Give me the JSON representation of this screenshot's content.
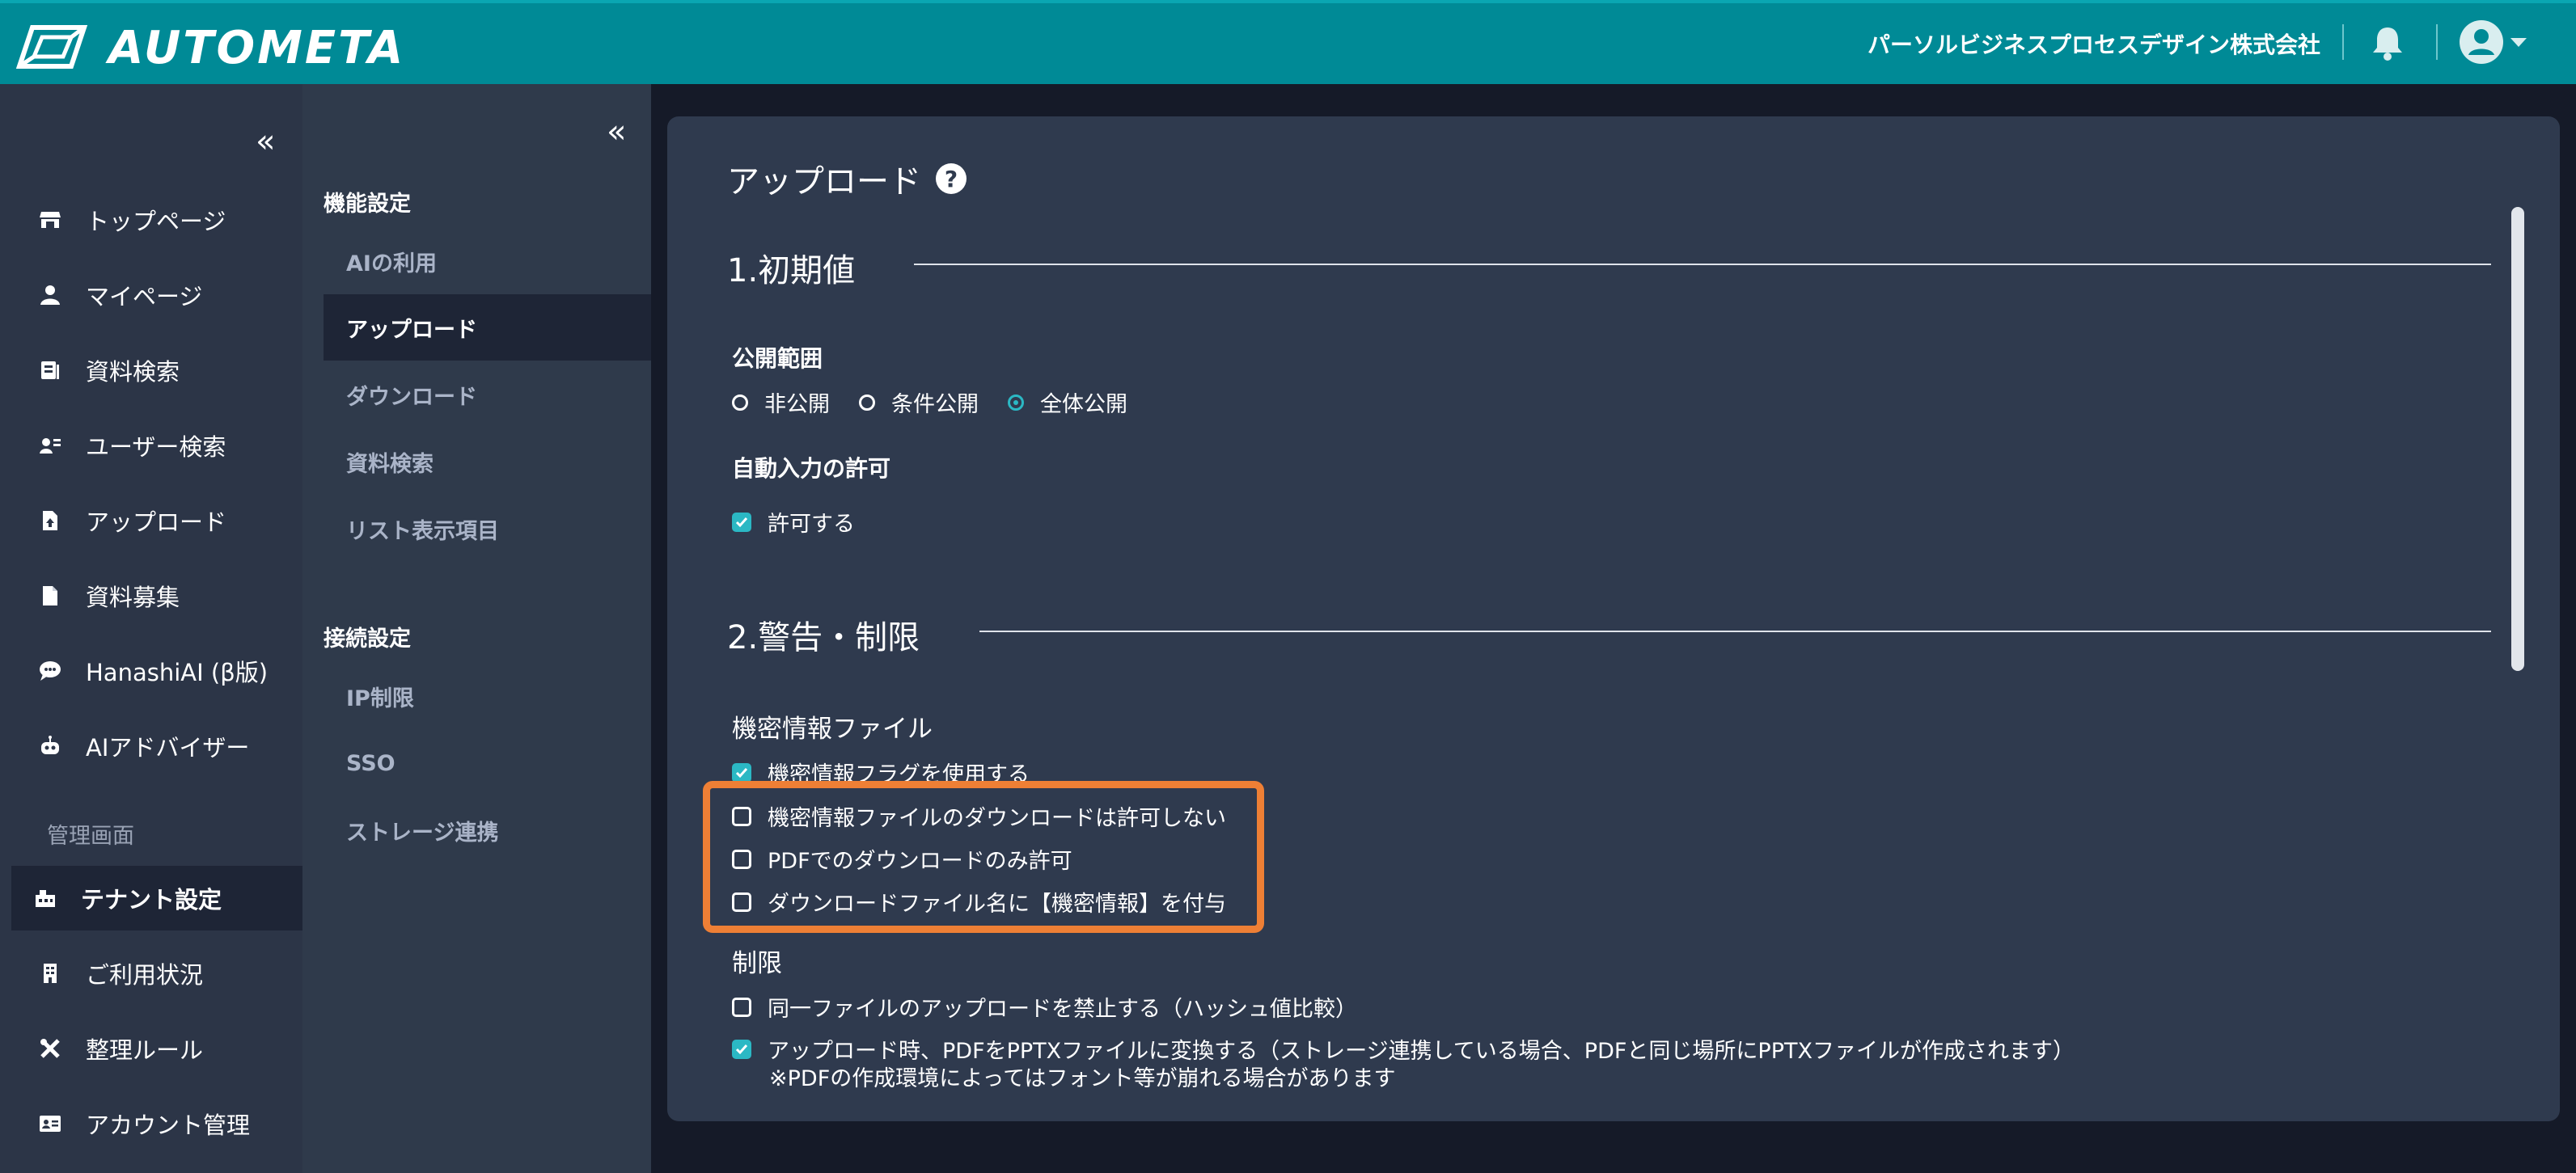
{
  "header": {
    "app_name": "AUTOMETA",
    "company": "パーソルビジネスプロセスデザイン株式会社",
    "icons": [
      "logo-icon",
      "bell-icon",
      "avatar-icon",
      "chevron-down-icon"
    ],
    "colors": {
      "header_bg": "#008a96",
      "accent": "#2bb8c4",
      "highlight": "#ee7f35"
    }
  },
  "sidebar": {
    "collapse_label": "«",
    "items": [
      {
        "label": "トップページ",
        "icon": "store-icon"
      },
      {
        "label": "マイページ",
        "icon": "person-icon"
      },
      {
        "label": "資料検索",
        "icon": "document-search-icon"
      },
      {
        "label": "ユーザー検索",
        "icon": "user-search-icon"
      },
      {
        "label": "アップロード",
        "icon": "upload-file-icon"
      },
      {
        "label": "資料募集",
        "icon": "file-icon"
      },
      {
        "label": "HanashiAI (β版)",
        "icon": "chat-icon"
      },
      {
        "label": "AIアドバイザー",
        "icon": "robot-icon"
      }
    ],
    "section_label": "管理画面",
    "admin_items": [
      {
        "label": "テナント設定",
        "icon": "tenant-icon",
        "active": true
      },
      {
        "label": "ご利用状況",
        "icon": "building-icon"
      },
      {
        "label": "整理ルール",
        "icon": "tools-icon"
      },
      {
        "label": "アカウント管理",
        "icon": "id-card-icon"
      }
    ]
  },
  "subsidebar": {
    "collapse_label": "«",
    "group1": "機能設定",
    "group1_items": [
      "AIの利用",
      "アップロード",
      "ダウンロード",
      "資料検索",
      "リスト表示項目"
    ],
    "group2": "接続設定",
    "group2_items": [
      "IP制限",
      "SSO",
      "ストレージ連携"
    ]
  },
  "main": {
    "title": "アップロード",
    "help": "?",
    "section1": {
      "title": "1.初期値",
      "visibility_label": "公開範囲",
      "visibility_options": [
        "非公開",
        "条件公開",
        "全体公開"
      ],
      "visibility_selected": "全体公開",
      "auto_input_label": "自動入力の許可",
      "auto_input_option": "許可する"
    },
    "section2": {
      "title": "2.警告・制限",
      "confidential_label": "機密情報ファイル",
      "confidential_options": [
        {
          "label": "機密情報フラグを使用する",
          "checked": true
        },
        {
          "label": "機密情報ファイルのダウンロードは許可しない",
          "checked": false
        },
        {
          "label": "PDFでのダウンロードのみ許可",
          "checked": false
        },
        {
          "label": "ダウンロードファイル名に【機密情報】を付与",
          "checked": false
        }
      ],
      "limit_label": "制限",
      "limit_options": [
        {
          "label": "同一ファイルのアップロードを禁止する（ハッシュ値比較）",
          "checked": false
        },
        {
          "label": "アップロード時、PDFをPPTXファイルに変換する（ストレージ連携している場合、PDFと同じ場所にPPTXファイルが作成されます）",
          "checked": true
        }
      ],
      "note": "※PDFの作成環境によってはフォント等が崩れる場合があります"
    }
  }
}
